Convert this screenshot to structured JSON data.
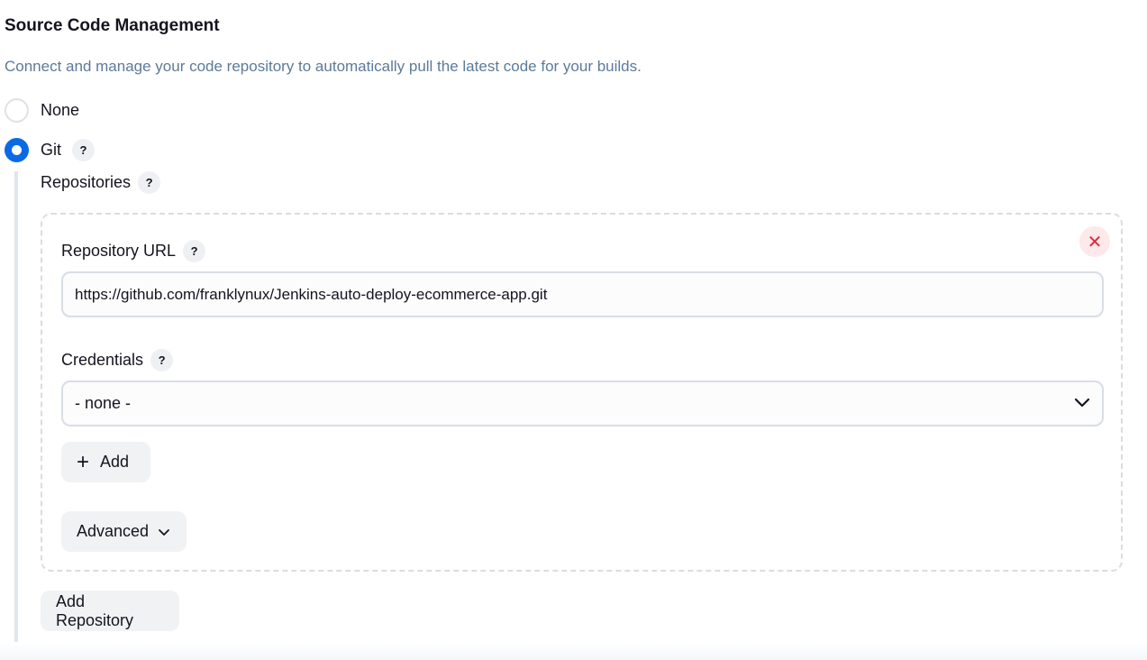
{
  "section": {
    "title": "Source Code Management",
    "description": "Connect and manage your code repository to automatically pull the latest code for your builds."
  },
  "scm_options": [
    {
      "label": "None",
      "selected": false
    },
    {
      "label": "Git",
      "selected": true
    }
  ],
  "help_glyph": "?",
  "repositories": {
    "label": "Repositories",
    "remove_glyph": "✕",
    "url_label": "Repository URL",
    "url_value": "https://github.com/franklynux/Jenkins-auto-deploy-ecommerce-app.git",
    "credentials_label": "Credentials",
    "credentials_value": "- none -",
    "add_plus": "+",
    "add_label": "Add",
    "advanced_label": "Advanced",
    "add_repository_label": "Add Repository"
  },
  "colors": {
    "accent": "#0b6ae3",
    "description": "#5c7a9a",
    "remove": "#d32f3f"
  },
  "icons": {
    "remove": "close-icon",
    "dropdown": "chevron-down-icon",
    "add": "plus-icon",
    "help": "help-icon"
  }
}
